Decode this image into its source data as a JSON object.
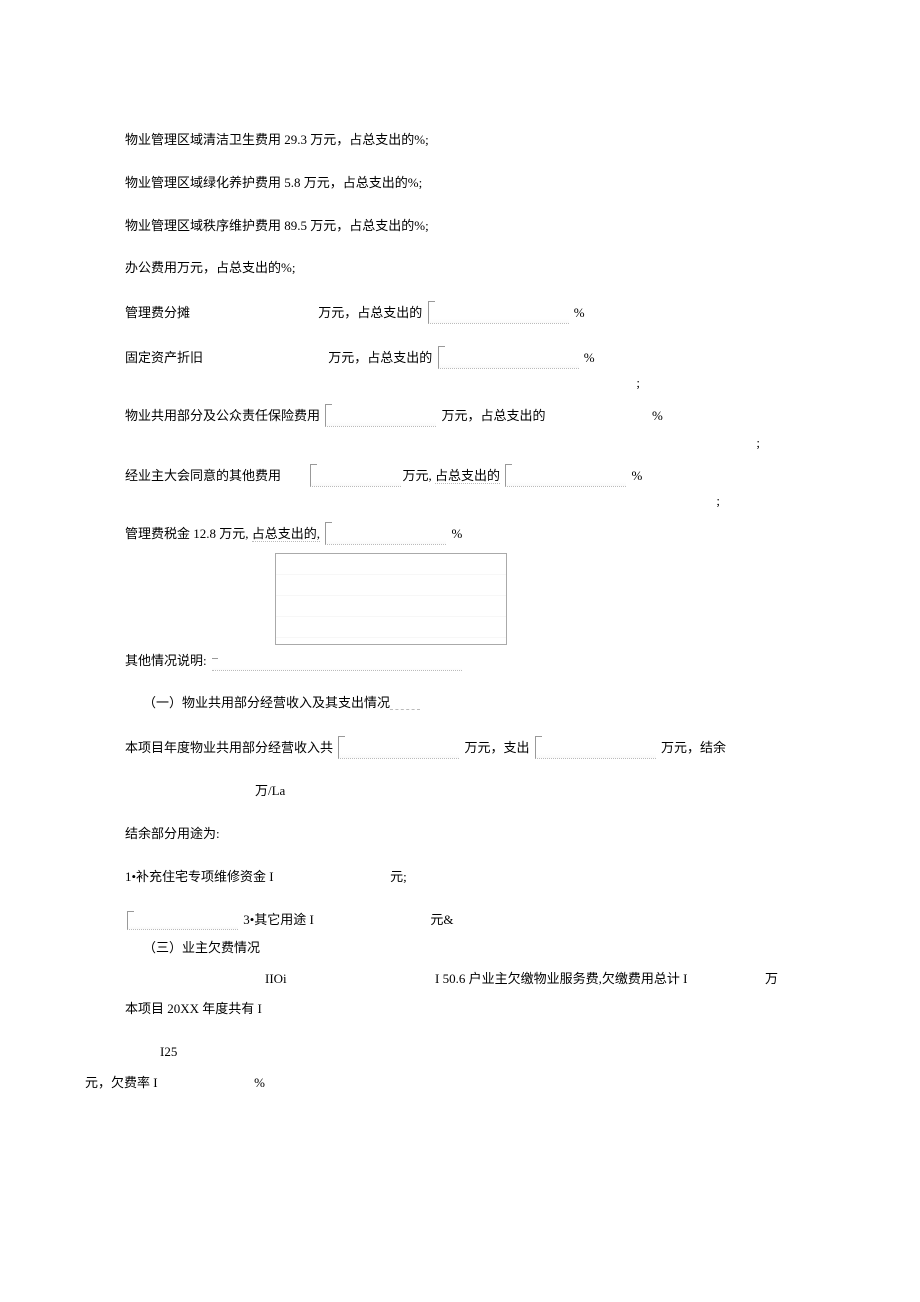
{
  "lines": {
    "l1_a": "物业管理区域清洁卫生费用 ",
    "l1_v": "29.3",
    "l1_b": " 万元，占总支出的%;",
    "l2_a": "物业管理区域绿化养护费用 ",
    "l2_v": "5.8",
    "l2_b": " 万元，占总支出的%;",
    "l3_a": "物业管理区域秩序维护费用 ",
    "l3_v": "89.5",
    "l3_b": " 万元，占总支出的%;",
    "l4": "办公费用万元，占总支出的%;",
    "l5_a": "管理费分摊",
    "l5_b": "万元，占总支出的",
    "l5_c": "%",
    "l6_a": "固定资产折旧",
    "l6_b": "万元，占总支出的",
    "l6_c": "%",
    "semi": ";",
    "l7_a": "物业共用部分及公众责任保险费用",
    "l7_b": "万元，占总支出的",
    "l7_c": "%",
    "l8_a": "经业主大会同意的其他费用",
    "l8_b": "万元,",
    "l8_bb": "占总支出的",
    "l8_c": "%",
    "l9_a": "管理费税金 ",
    "l9_v": "12.8",
    "l9_b": " 万元,",
    "l9_bb": "占总支出的,",
    "l9_c": "%",
    "l10_a": "其他情况说明:",
    "sec2_title": "（一）物业共用部分经营收入及其支出情况",
    "sec2_a": "本项目年度物业共用部分经营收入共",
    "sec2_b": "万元，支出",
    "sec2_c": "万元，结余",
    "sec2_d": "万/La",
    "sec2_e": "结余部分用途为:",
    "item1_a": "1•补充住宅专项维修资金 I",
    "item1_b": "元;",
    "item3_a": "3•其它用途 I",
    "item3_b": "元&",
    "sec3_title": "（三）业主欠费情况",
    "sec3_sub": "IIOi",
    "sec3_a": "本项目 20XX 年度共有 I",
    "sec3_mid": "I 50.6 户业主欠缴物业服务费,欠缴费用总计 I",
    "sec3_c": "万",
    "sec3_sub2": "I25",
    "sec3_d": "元，欠费率 I",
    "sec3_e": "%"
  }
}
